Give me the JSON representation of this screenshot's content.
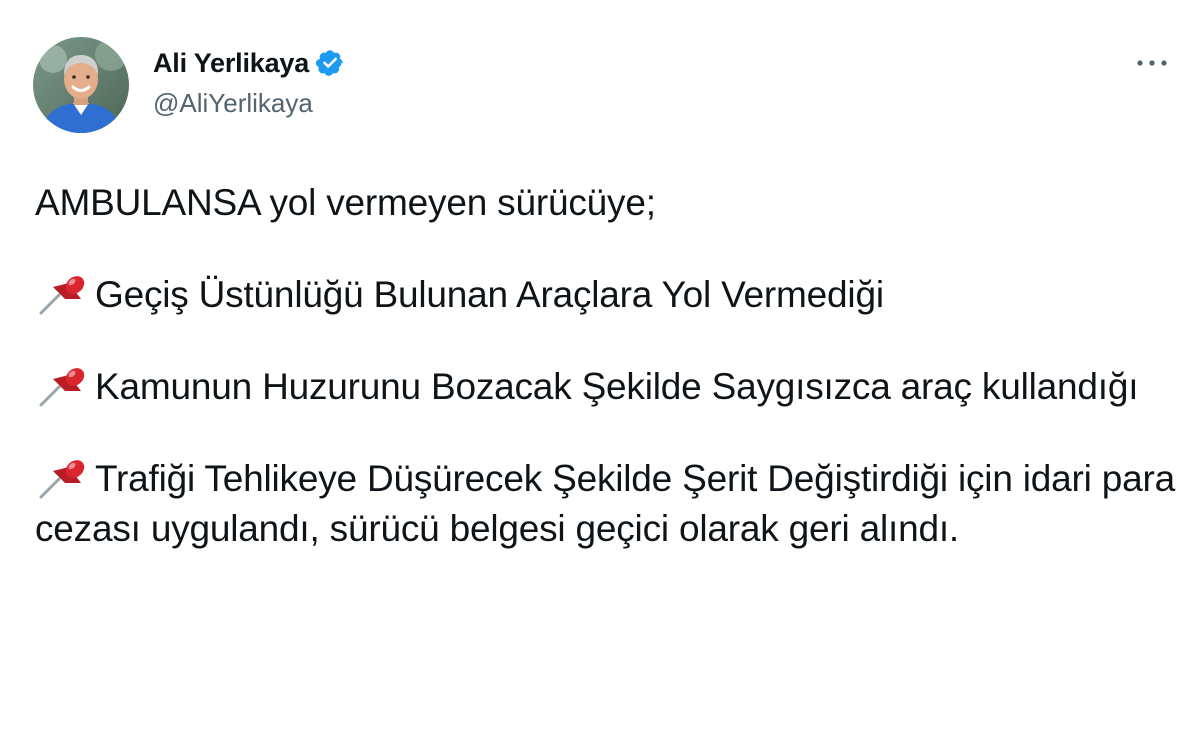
{
  "author": {
    "display_name": "Ali Yerlikaya",
    "handle": "@AliYerlikaya",
    "verified": true
  },
  "icons": {
    "avatar": "profile-photo",
    "verified": "verified-badge-icon",
    "more": "more-options-icon",
    "bullet": "pushpin-icon"
  },
  "colors": {
    "verified_badge": "#1d9bf0",
    "handle": "#536471",
    "text": "#0f1419",
    "pin_red": "#d9262e"
  },
  "tweet": {
    "intro": "AMBULANSA yol vermeyen sürücüye;",
    "items": [
      "Geçiş Üstünlüğü Bulunan Araçlara Yol Vermediği",
      "Kamunun Huzurunu Bozacak Şekilde Saygısızca araç kullandığı",
      "Trafiği Tehlikeye Düşürecek Şekilde Şerit Değiştirdiği için idari para cezası uygulandı, sürücü belgesi geçici olarak geri alındı."
    ]
  }
}
